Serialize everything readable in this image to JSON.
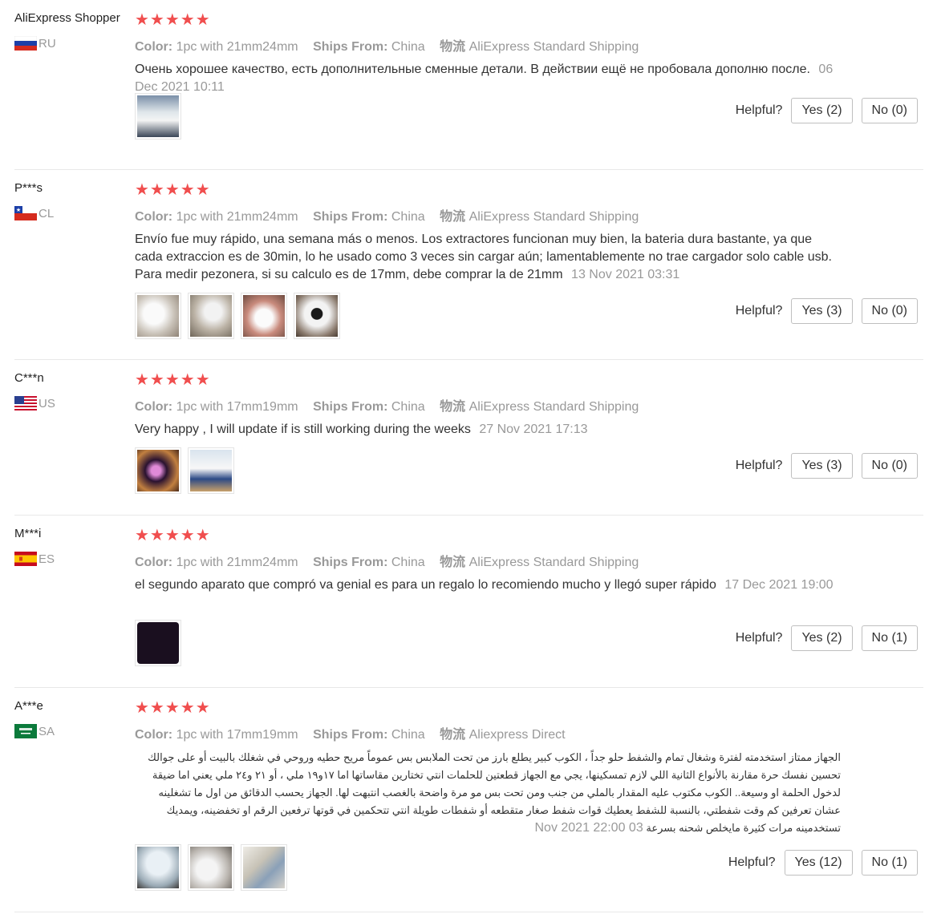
{
  "labels": {
    "color": "Color:",
    "ships_from": "Ships From:",
    "logistics": "物流",
    "helpful": "Helpful?"
  },
  "colors": {
    "star": "#f04e4e",
    "meta": "#999999"
  },
  "reviews": [
    {
      "user": "AliExpress Shopper",
      "country": "RU",
      "flag": "russia-flag",
      "stars": "★★★★★",
      "color": "1pc with 21mm24mm",
      "ships_from": "China",
      "logistics": "AliExpress Standard Shipping",
      "text": "Очень хорошее качество, есть дополнительные сменные детали. В действии ещё не пробовала дополню после.",
      "date": "06 Dec 2021 10:11",
      "yes": "Yes (2)",
      "no": "No (0)",
      "images": [
        "product-photo"
      ]
    },
    {
      "user": "P***s",
      "country": "CL",
      "flag": "chile-flag",
      "stars": "★★★★★",
      "color": "1pc with 21mm24mm",
      "ships_from": "China",
      "logistics": "AliExpress Standard Shipping",
      "text": "Envío fue muy rápido, una semana más o menos. Los extractores funcionan muy bien, la bateria dura bastante, ya que cada extraccion es de 30min, lo he usado como 3 veces sin cargar aún; lamentablemente no trae cargador solo cable usb. Para medir pezonera, si su calculo es de 17mm, debe comprar la de 21mm",
      "date": "13 Nov 2021 03:31",
      "yes": "Yes (3)",
      "no": "No (0)",
      "images": [
        "box-photo",
        "parts-photo",
        "pump-photo",
        "display-photo"
      ]
    },
    {
      "user": "C***n",
      "country": "US",
      "flag": "usa-flag",
      "stars": "★★★★★",
      "color": "1pc with 17mm19mm",
      "ships_from": "China",
      "logistics": "AliExpress Standard Shipping",
      "text": "Very happy , I will update if is still working during the weeks",
      "date": "27 Nov 2021 17:13",
      "yes": "Yes (3)",
      "no": "No (0)",
      "images": [
        "screen-photo",
        "cup-photo"
      ]
    },
    {
      "user": "M***i",
      "country": "ES",
      "flag": "spain-flag",
      "stars": "★★★★★",
      "color": "1pc with 21mm24mm",
      "ships_from": "China",
      "logistics": "AliExpress Standard Shipping",
      "text": "el segundo aparato que compró va genial es para un regalo lo recomiendo mucho y llegó super rápido",
      "date": "17 Dec 2021 19:00",
      "yes": "Yes (2)",
      "no": "No (1)",
      "images": [
        "dark-photo"
      ]
    },
    {
      "user": "A***e",
      "country": "SA",
      "flag": "saudi-flag",
      "stars": "★★★★★",
      "color": "1pc with 17mm19mm",
      "ships_from": "China",
      "logistics": "Aliexpress Direct",
      "text": "الجهاز ممتاز استخدمته لفترة وشغال تمام والشفط حلو جداً ، الكوب كبير يطلع بارز من تحت الملابس بس عموماً مريح حطيه وروحي في شغلك بالبيت أو على جوالك تحسين نفسك حرة مقارنة بالأنواع الثانية اللي لازم تمسكينها، يجي مع الجهاز قطعتين للحلمات انتي تختارين مقاساتها اما ١٧و١٩ ملي ، أو ٢١ و٢٤ ملي يعني اما ضيقة لدخول الحلمة او وسيعة.. الكوب مكتوب عليه المقدار بالملي من جنب ومن تحت بس مو مرة واضحة بالغصب انتبهت لها. الجهاز يحسب الدقائق من اول ما تشغلينه عشان تعرفين كم وقت شفطتي، بالنسبة للشفط يعطيك قوات شفط صغار متقطعه أو شفطات طويلة انتي تتحكمين في قوتها ترفعين الرقم او تخفضينه، ويمديك تستخدمينه مرات كثيرة مايخلص شحنه بسرعة",
      "date": "03 Nov 2021 22:00",
      "yes": "Yes (12)",
      "no": "No (1)",
      "images": [
        "cup-closeup-photo",
        "flange-photo",
        "box-display-photo"
      ]
    }
  ]
}
